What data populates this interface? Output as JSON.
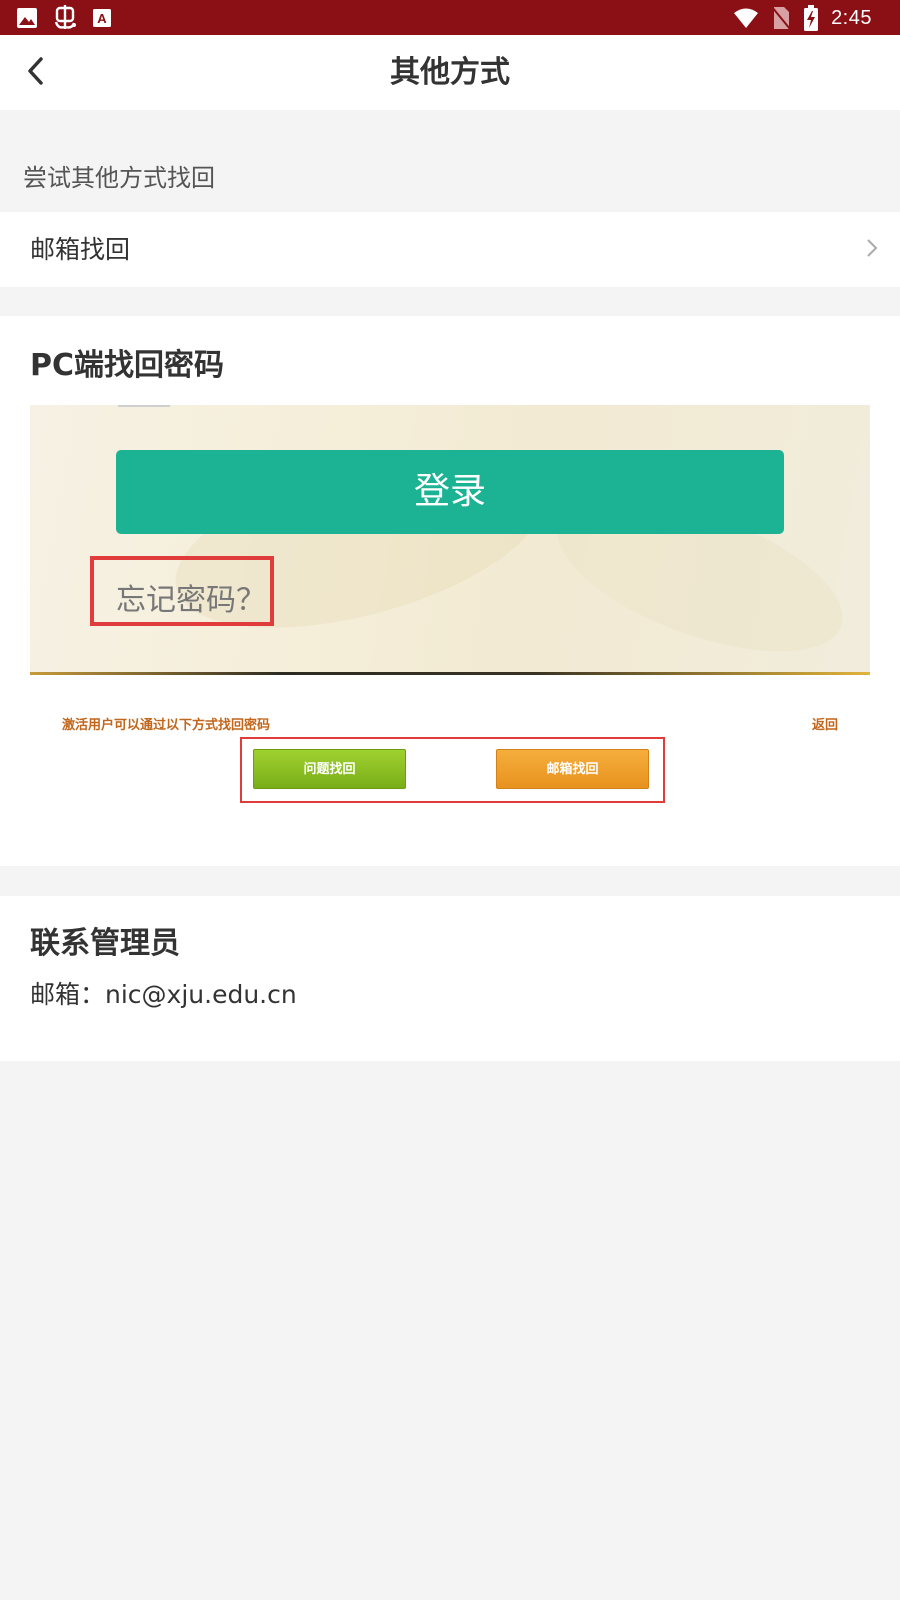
{
  "status_bar": {
    "time": "2:45",
    "left_icons": [
      "image-icon",
      "bug-icon",
      "text-recognition-icon"
    ],
    "right_icons": [
      "wifi-icon",
      "no-sim-icon",
      "battery-charging-icon"
    ],
    "background": "#8b1016"
  },
  "header": {
    "title": "其他方式"
  },
  "section": {
    "caption": "尝试其他方式找回"
  },
  "email_recovery": {
    "label": "邮箱找回"
  },
  "pc_card": {
    "title": "PC端找回密码",
    "screenshot": {
      "login_button": "登录",
      "forgot_link": "忘记密码？",
      "hint": "激活用户可以通过以下方式找回密码",
      "return": "返回",
      "question_button": "问题找回",
      "email_button": "邮箱找回"
    }
  },
  "contact": {
    "title": "联系管理员",
    "email": "邮箱：nic@xju.edu.cn"
  },
  "colors": {
    "accent_red": "#8b1016",
    "login_green": "#1bb394",
    "highlight_red": "#e03c3c",
    "question_green": "#8cc222",
    "email_orange": "#f0a030"
  }
}
